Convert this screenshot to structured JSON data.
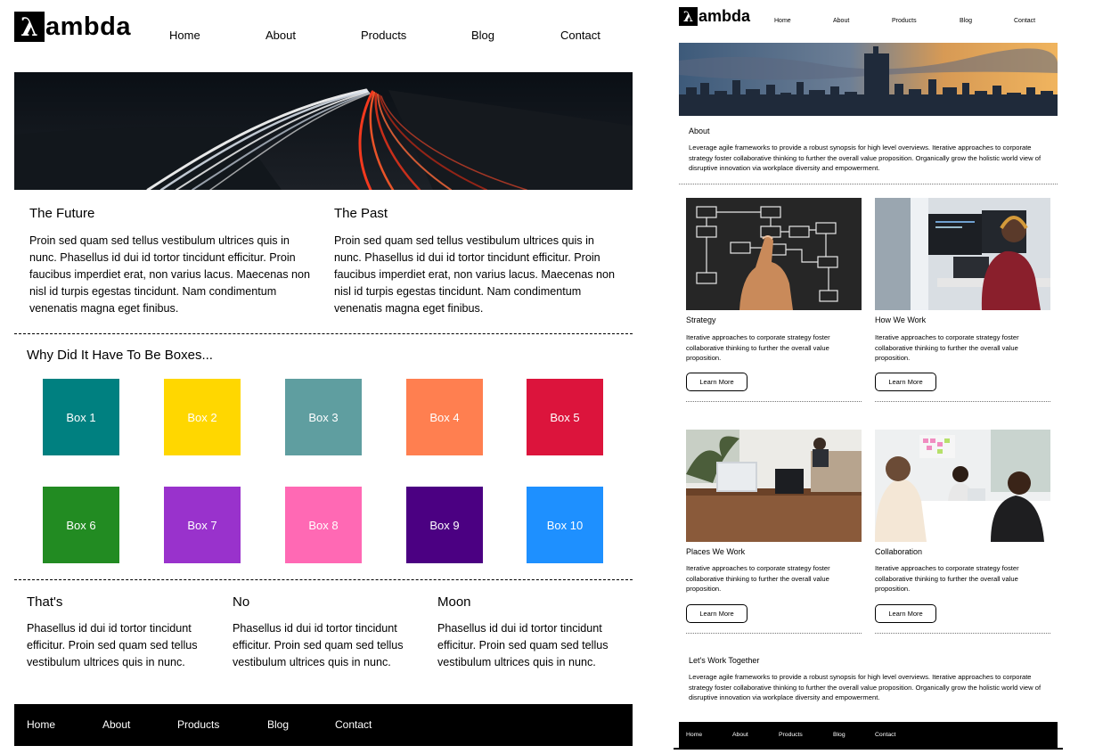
{
  "left": {
    "logo": {
      "symbol": "λ",
      "text": "ambda"
    },
    "nav": [
      "Home",
      "About",
      "Products",
      "Blog",
      "Contact"
    ],
    "columns": [
      {
        "title": "The Future",
        "text": "Proin sed quam sed tellus vestibulum ultrices quis in nunc. Phasellus id dui id tortor tincidunt efficitur. Proin faucibus imperdiet erat, non varius lacus. Maecenas non nisl id turpis egestas tincidunt. Nam condimentum venenatis magna eget finibus."
      },
      {
        "title": "The Past",
        "text": "Proin sed quam sed tellus vestibulum ultrices quis in nunc. Phasellus id dui id tortor tincidunt efficitur. Proin faucibus imperdiet erat, non varius lacus. Maecenas non nisl id turpis egestas tincidunt. Nam condimentum venenatis magna eget finibus."
      }
    ],
    "boxes_heading": "Why Did It Have To Be Boxes...",
    "boxes": [
      {
        "label": "Box 1",
        "color": "#008080"
      },
      {
        "label": "Box 2",
        "color": "#FFD700"
      },
      {
        "label": "Box 3",
        "color": "#5F9EA0"
      },
      {
        "label": "Box 4",
        "color": "#FF7F50"
      },
      {
        "label": "Box 5",
        "color": "#DC143C"
      },
      {
        "label": "Box 6",
        "color": "#228B22"
      },
      {
        "label": "Box 7",
        "color": "#9932CC"
      },
      {
        "label": "Box 8",
        "color": "#FF69B4"
      },
      {
        "label": "Box 9",
        "color": "#4B0082"
      },
      {
        "label": "Box 10",
        "color": "#1E90FF"
      }
    ],
    "bottom_columns": [
      {
        "title": "That's",
        "text": "Phasellus id dui id tortor tincidunt efficitur. Proin sed quam sed tellus vestibulum ultrices quis in nunc."
      },
      {
        "title": "No",
        "text": "Phasellus id dui id tortor tincidunt efficitur. Proin sed quam sed tellus vestibulum ultrices quis in nunc."
      },
      {
        "title": "Moon",
        "text": "Phasellus id dui id tortor tincidunt efficitur. Proin sed quam sed tellus vestibulum ultrices quis in nunc."
      }
    ],
    "footer_nav": [
      "Home",
      "About",
      "Products",
      "Blog",
      "Contact"
    ]
  },
  "right": {
    "logo": {
      "symbol": "λ",
      "text": "ambda"
    },
    "nav": [
      "Home",
      "About",
      "Products",
      "Blog",
      "Contact"
    ],
    "about": {
      "title": "About",
      "text": "Leverage agile frameworks to provide a robust synopsis for high level overviews. Iterative approaches to corporate strategy foster collaborative thinking to further the overall value proposition. Organically grow the holistic world view of disruptive innovation via workplace diversity and empowerment."
    },
    "cards": [
      {
        "title": "Strategy",
        "text": "Iterative approaches to corporate strategy foster collaborative thinking to further the overall value proposition.",
        "button": "Learn More"
      },
      {
        "title": "How We Work",
        "text": "Iterative approaches to corporate strategy foster collaborative thinking to further the overall value proposition.",
        "button": "Learn More"
      },
      {
        "title": "Places We Work",
        "text": "Iterative approaches to corporate strategy foster collaborative thinking to further the overall value proposition.",
        "button": "Learn More"
      },
      {
        "title": "Collaboration",
        "text": "Iterative approaches to corporate strategy foster collaborative thinking to further the overall value proposition.",
        "button": "Learn More"
      }
    ],
    "together": {
      "title": "Let's Work Together",
      "text": "Leverage agile frameworks to provide a robust synopsis for high level overviews. Iterative approaches to corporate strategy foster collaborative thinking to further the overall value proposition. Organically grow the holistic world view of disruptive innovation via workplace diversity and empowerment."
    },
    "footer_nav": [
      "Home",
      "About",
      "Products",
      "Blog",
      "Contact"
    ]
  }
}
